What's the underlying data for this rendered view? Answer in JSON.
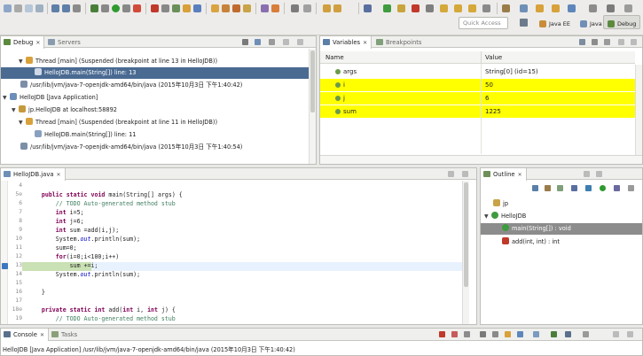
{
  "toolbar": {
    "quick_access_placeholder": "Quick Access",
    "perspectives": [
      {
        "label": "Java EE"
      },
      {
        "label": "Java"
      },
      {
        "label": "Debug"
      }
    ]
  },
  "debug_view": {
    "tabs": [
      {
        "label": "Debug",
        "close": "✕"
      },
      {
        "label": "Servers"
      }
    ],
    "tree": [
      {
        "text": "Thread [main] (Suspended (breakpoint at line 13 in HelloJDB))"
      },
      {
        "text": "HelloJDB.main(String[]) line: 13"
      },
      {
        "text": "/usr/lib/jvm/java-7-openjdk-amd64/bin/java (2015年10月3日 下午1:40:42)"
      },
      {
        "text": "HelloJDB [Java Application]"
      },
      {
        "text": "jp.HelloJDB at localhost:58892"
      },
      {
        "text": "Thread [main] (Suspended (breakpoint at line 11 in HelloJDB))"
      },
      {
        "text": "HelloJDB.main(String[]) line: 11"
      },
      {
        "text": "/usr/lib/jvm/java-7-openjdk-amd64/bin/java (2015年10月3日 下午1:40:54)"
      }
    ]
  },
  "variables_view": {
    "tabs": [
      {
        "label": "Variables",
        "close": "✕"
      },
      {
        "label": "Breakpoints"
      }
    ],
    "columns": [
      "Name",
      "Value"
    ],
    "rows": [
      {
        "name": "args",
        "value": "String[0]  (id=15)",
        "highlight": false
      },
      {
        "name": "i",
        "value": "50",
        "highlight": true
      },
      {
        "name": "j",
        "value": "6",
        "highlight": true
      },
      {
        "name": "sum",
        "value": "1225",
        "highlight": true
      }
    ]
  },
  "editor": {
    "tab": {
      "label": "HelloJDB.java",
      "close": "✕"
    },
    "lines": [
      {
        "num": "4",
        "text": ""
      },
      {
        "num": "5⊖",
        "text": "    public static void main(String[] args) {"
      },
      {
        "num": "6",
        "text": "        // TODO Auto-generated method stub"
      },
      {
        "num": "7",
        "text": "        int i=5;"
      },
      {
        "num": "8",
        "text": "        int j=6;"
      },
      {
        "num": "9",
        "text": "        int sum =add(i,j);"
      },
      {
        "num": "10",
        "text": "        System.out.println(sum);"
      },
      {
        "num": "11",
        "text": "        sum=0;"
      },
      {
        "num": "12",
        "text": "        for(i=0;i<100;i++)"
      },
      {
        "num": "13",
        "text": "            sum +=i;"
      },
      {
        "num": "14",
        "text": "        System.out.println(sum);"
      },
      {
        "num": "15",
        "text": ""
      },
      {
        "num": "16",
        "text": "    }"
      },
      {
        "num": "17",
        "text": ""
      },
      {
        "num": "18⊖",
        "text": "    private static int add(int i, int j) {"
      },
      {
        "num": "19",
        "text": "        // TODO Auto-generated method stub"
      }
    ]
  },
  "outline_view": {
    "tab": {
      "label": "Outline",
      "close": "✕"
    },
    "items": [
      {
        "text": "jp"
      },
      {
        "text": "HelloJDB"
      },
      {
        "text": "main(String[]) : void"
      },
      {
        "text": "add(int, int) : int"
      }
    ]
  },
  "console_view": {
    "tabs": [
      {
        "label": "Console",
        "close": "✕"
      },
      {
        "label": "Tasks"
      }
    ],
    "status": "HelloJDB [Java Application] /usr/lib/jvm/java-7-openjdk-amd64/bin/java (2015年10月3日 下午1:40:42)"
  }
}
